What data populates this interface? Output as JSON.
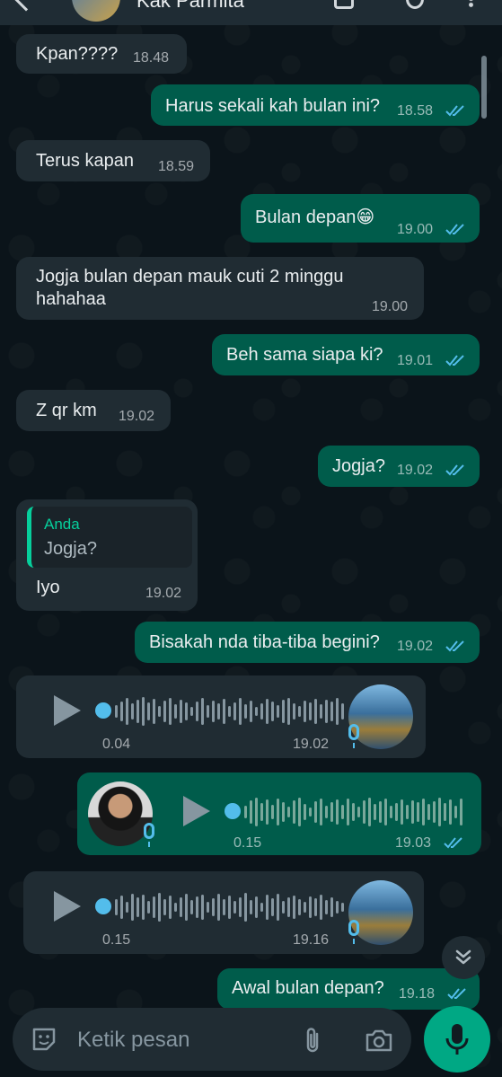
{
  "header": {
    "contact_name": "Kak Parmita"
  },
  "messages": [
    {
      "dir": "in",
      "text": "Kpan????",
      "time": "18.48"
    },
    {
      "dir": "out",
      "text": "Harus sekali kah bulan ini?",
      "time": "18.58",
      "read": true
    },
    {
      "dir": "in",
      "text": "Terus kapan",
      "time": "18.59"
    },
    {
      "dir": "out",
      "text": "Bulan depan😁",
      "time": "19.00",
      "read": true
    },
    {
      "dir": "in",
      "text_line1": "Jogja bulan depan mauk cuti 2 minggu",
      "text_line2": "hahahaa",
      "time": "19.00"
    },
    {
      "dir": "out",
      "text": "Beh sama siapa ki?",
      "time": "19.01",
      "read": true
    },
    {
      "dir": "in",
      "text": "Z qr km",
      "time": "19.02"
    },
    {
      "dir": "out",
      "text": "Jogja?",
      "time": "19.02",
      "read": true
    },
    {
      "dir": "in",
      "quote_name": "Anda",
      "quote_text": "Jogja?",
      "text": "Iyo",
      "time": "19.02"
    },
    {
      "dir": "out",
      "text": "Bisakah nda tiba-tiba begini?",
      "time": "19.02",
      "read": true
    },
    {
      "dir": "in",
      "type": "voice",
      "duration": "0.04",
      "time": "19.02"
    },
    {
      "dir": "out",
      "type": "voice",
      "duration": "0.15",
      "time": "19.03",
      "read": true
    },
    {
      "dir": "in",
      "type": "voice",
      "duration": "0.15",
      "time": "19.16"
    },
    {
      "dir": "out",
      "text": "Awal bulan depan?",
      "time": "19.18",
      "read": true
    }
  ],
  "input": {
    "placeholder": "Ketik pesan"
  },
  "colors": {
    "outgoing_bubble": "#005c4b",
    "incoming_bubble": "#202c33",
    "read_check": "#53bdeb",
    "accent": "#00a884"
  },
  "icons": [
    "back-arrow-icon",
    "video-call-icon",
    "phone-icon",
    "more-icon",
    "play-icon",
    "mic-icon",
    "sticker-icon",
    "attach-icon",
    "camera-icon",
    "chevron-double-down-icon"
  ]
}
